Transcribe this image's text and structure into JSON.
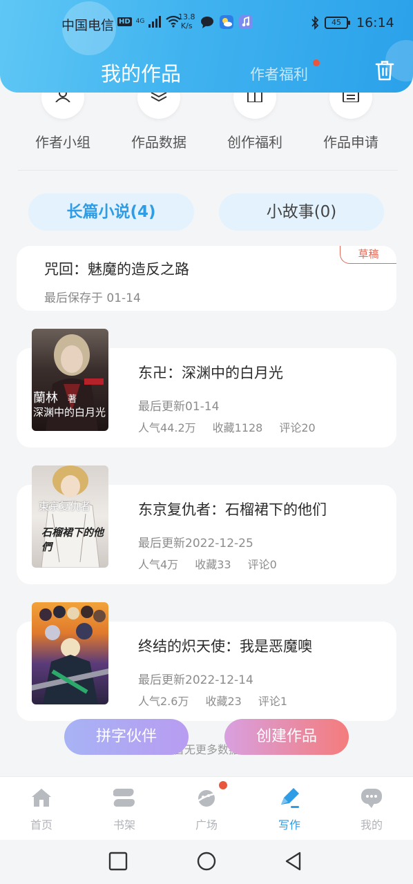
{
  "status_bar": {
    "carrier": "中国电信",
    "hd": "HD",
    "network": "4G",
    "net_speed_value": "13.8",
    "net_speed_unit": "K/s",
    "battery": "45",
    "time": "16:14"
  },
  "header": {
    "title": "我的作品",
    "tab_welfare": "作者福利"
  },
  "quick_actions": [
    {
      "label": "作者小组",
      "icon": "group-icon"
    },
    {
      "label": "作品数据",
      "icon": "layers-icon"
    },
    {
      "label": "创作福利",
      "icon": "gift-icon"
    },
    {
      "label": "作品申请",
      "icon": "document-icon"
    }
  ],
  "category_tabs": {
    "novel": "长篇小说(4)",
    "story": "小故事(0)"
  },
  "draft": {
    "title": "咒回：魅魔的造反之路",
    "saved": "最后保存于 01-14",
    "badge": "草稿"
  },
  "books": [
    {
      "title": "东卍：深渊中的白月光",
      "updated": "最后更新01-14",
      "popularity": "人气44.2万",
      "favorites": "收藏1128",
      "comments": "评论20",
      "cover_author": "蘭林",
      "cover_author_suffix": "著",
      "cover_title": "深渊中的白月光"
    },
    {
      "title": "东京复仇者：石榴裙下的他们",
      "updated": "最后更新2022-12-25",
      "popularity": "人气4万",
      "favorites": "收藏33",
      "comments": "评论0",
      "cover_title": "東京复仇者",
      "cover_sub": "石榴裙下的他們"
    },
    {
      "title": "终结的炽天使：我是恶魔噢",
      "updated": "最后更新2022-12-14",
      "popularity": "人气2.6万",
      "favorites": "收藏23",
      "comments": "评论1"
    }
  ],
  "no_more": "暂无更多数据",
  "fab": {
    "partner": "拼字伙伴",
    "create": "创建作品"
  },
  "bottom_nav": [
    {
      "label": "首页",
      "icon": "home-icon"
    },
    {
      "label": "书架",
      "icon": "bookshelf-icon"
    },
    {
      "label": "广场",
      "icon": "planet-icon"
    },
    {
      "label": "写作",
      "icon": "pen-icon"
    },
    {
      "label": "我的",
      "icon": "chat-bubble-icon"
    }
  ],
  "colors": {
    "accent": "#2f9ce6",
    "header_start": "#5fc7f5",
    "header_end": "#2aa1ea",
    "badge_red": "#e06a5a",
    "dot_red": "#e8573d"
  }
}
